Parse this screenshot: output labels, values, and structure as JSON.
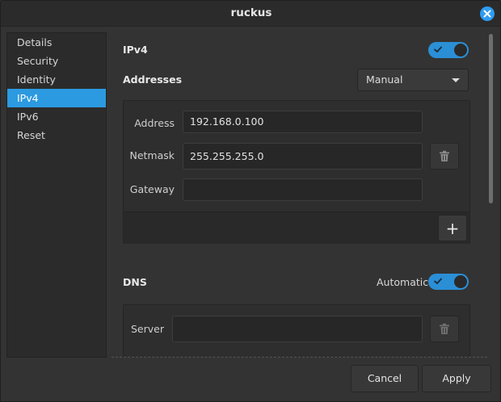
{
  "window": {
    "title": "ruckus"
  },
  "sidebar": {
    "items": [
      {
        "label": "Details"
      },
      {
        "label": "Security"
      },
      {
        "label": "Identity"
      },
      {
        "label": "IPv4",
        "active": true
      },
      {
        "label": "IPv6"
      },
      {
        "label": "Reset"
      }
    ]
  },
  "ipv4": {
    "title": "IPv4",
    "enabled": true,
    "addresses_label": "Addresses",
    "method": "Manual",
    "fields": {
      "address_label": "Address",
      "address_value": "192.168.0.100",
      "netmask_label": "Netmask",
      "netmask_value": "255.255.255.0",
      "gateway_label": "Gateway",
      "gateway_value": ""
    },
    "add_label": "+"
  },
  "dns": {
    "title": "DNS",
    "automatic_label": "Automatic",
    "automatic": true,
    "server_label": "Server",
    "server_value": ""
  },
  "actions": {
    "cancel_label": "Cancel",
    "apply_label": "Apply"
  },
  "colors": {
    "accent": "#2c9ae0",
    "background": "#333333",
    "panel": "#2e2e2e"
  }
}
